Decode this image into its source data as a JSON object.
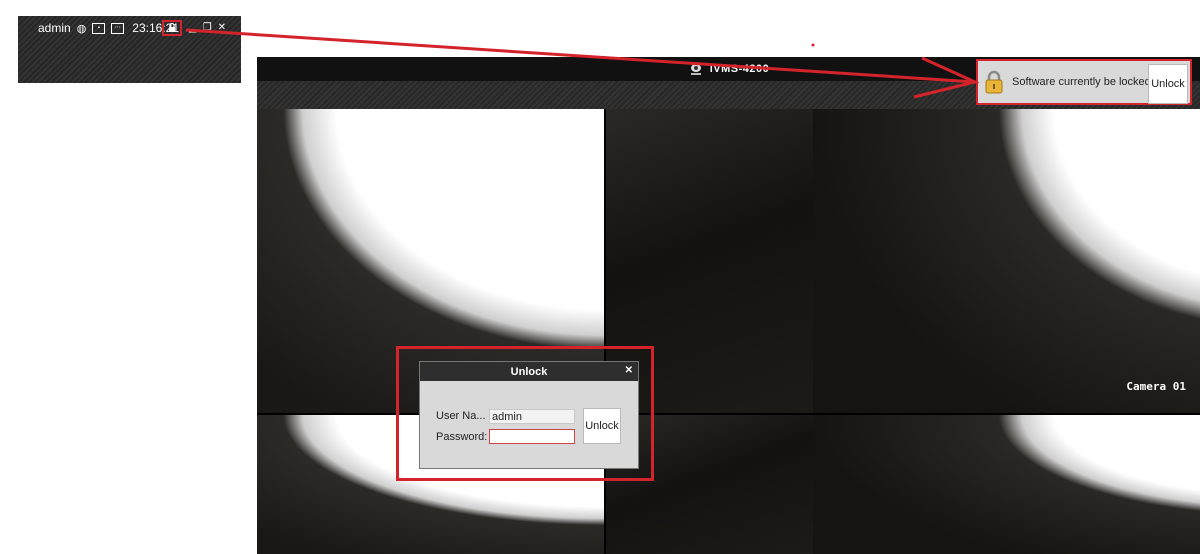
{
  "zoom_toolbar": {
    "username": "admin",
    "icons": [
      "globe-icon",
      "monitor-icon",
      "keyboard-icon",
      "lock-icon",
      "minimize-icon",
      "restore-icon",
      "close-icon"
    ],
    "time": "23:16:21"
  },
  "window": {
    "app_title": "iVMS-4200"
  },
  "lock_notice": {
    "message": "Software currently be locked.",
    "unlock_label": "Unlock"
  },
  "video": {
    "camera_label": "Camera 01"
  },
  "unlock_dialog": {
    "title": "Unlock",
    "username_label": "User Na...",
    "username_value": "admin",
    "password_label": "Password:",
    "password_value": "",
    "unlock_label": "Unlock"
  },
  "colors": {
    "highlight": "#d4232a",
    "titlebar": "#111111",
    "dialog_bg": "#d9d9d9"
  }
}
